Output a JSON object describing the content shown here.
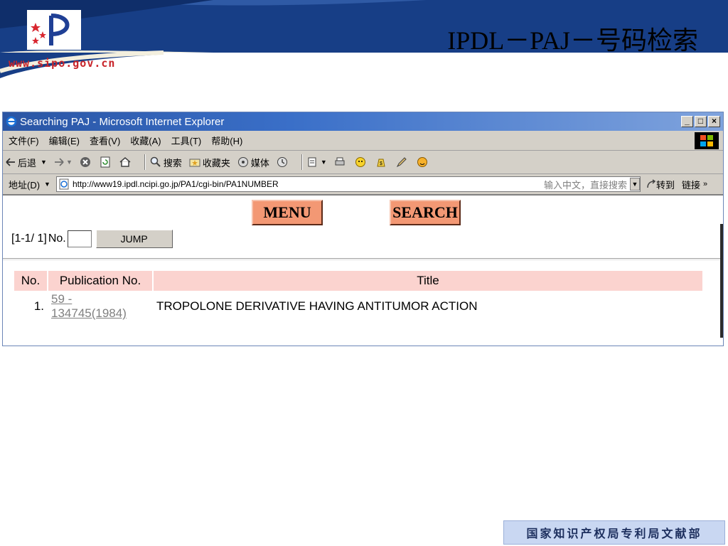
{
  "slide": {
    "title": "IPDL－PAJ－号码检索",
    "site_url": "www.sipo.gov.cn",
    "footer": "国家知识产权局专利局文献部",
    "colors": {
      "header_blue": "#173e86",
      "header_cream": "#f3efde",
      "url_red": "#c8242a"
    }
  },
  "browser": {
    "window_title": "Searching PAJ - Microsoft Internet Explorer",
    "window_buttons": [
      "_",
      "□",
      "×"
    ],
    "menu": [
      "文件(F)",
      "编辑(E)",
      "查看(V)",
      "收藏(A)",
      "工具(T)",
      "帮助(H)"
    ],
    "toolbar": {
      "back": "后退",
      "search": "搜索",
      "favorites": "收藏夹",
      "media": "媒体"
    },
    "address": {
      "label": "地址(D)",
      "url": "http://www19.ipdl.ncipi.go.jp/PA1/cgi-bin/PA1NUMBER",
      "hint": "输入中文，直接搜索",
      "go": "转到",
      "links": "链接"
    }
  },
  "page": {
    "menu_button": "MENU",
    "search_button": "SEARCH",
    "range": "[1-1/ 1]",
    "no_label": "No.",
    "no_value": "",
    "jump_button": "JUMP",
    "results": {
      "headers": {
        "no": "No.",
        "publication": "Publication No.",
        "title": "Title"
      },
      "rows": [
        {
          "no": "1.",
          "publication": "59 - 134745(1984)",
          "title": "TROPOLONE DERIVATIVE HAVING ANTITUMOR ACTION"
        }
      ]
    }
  }
}
